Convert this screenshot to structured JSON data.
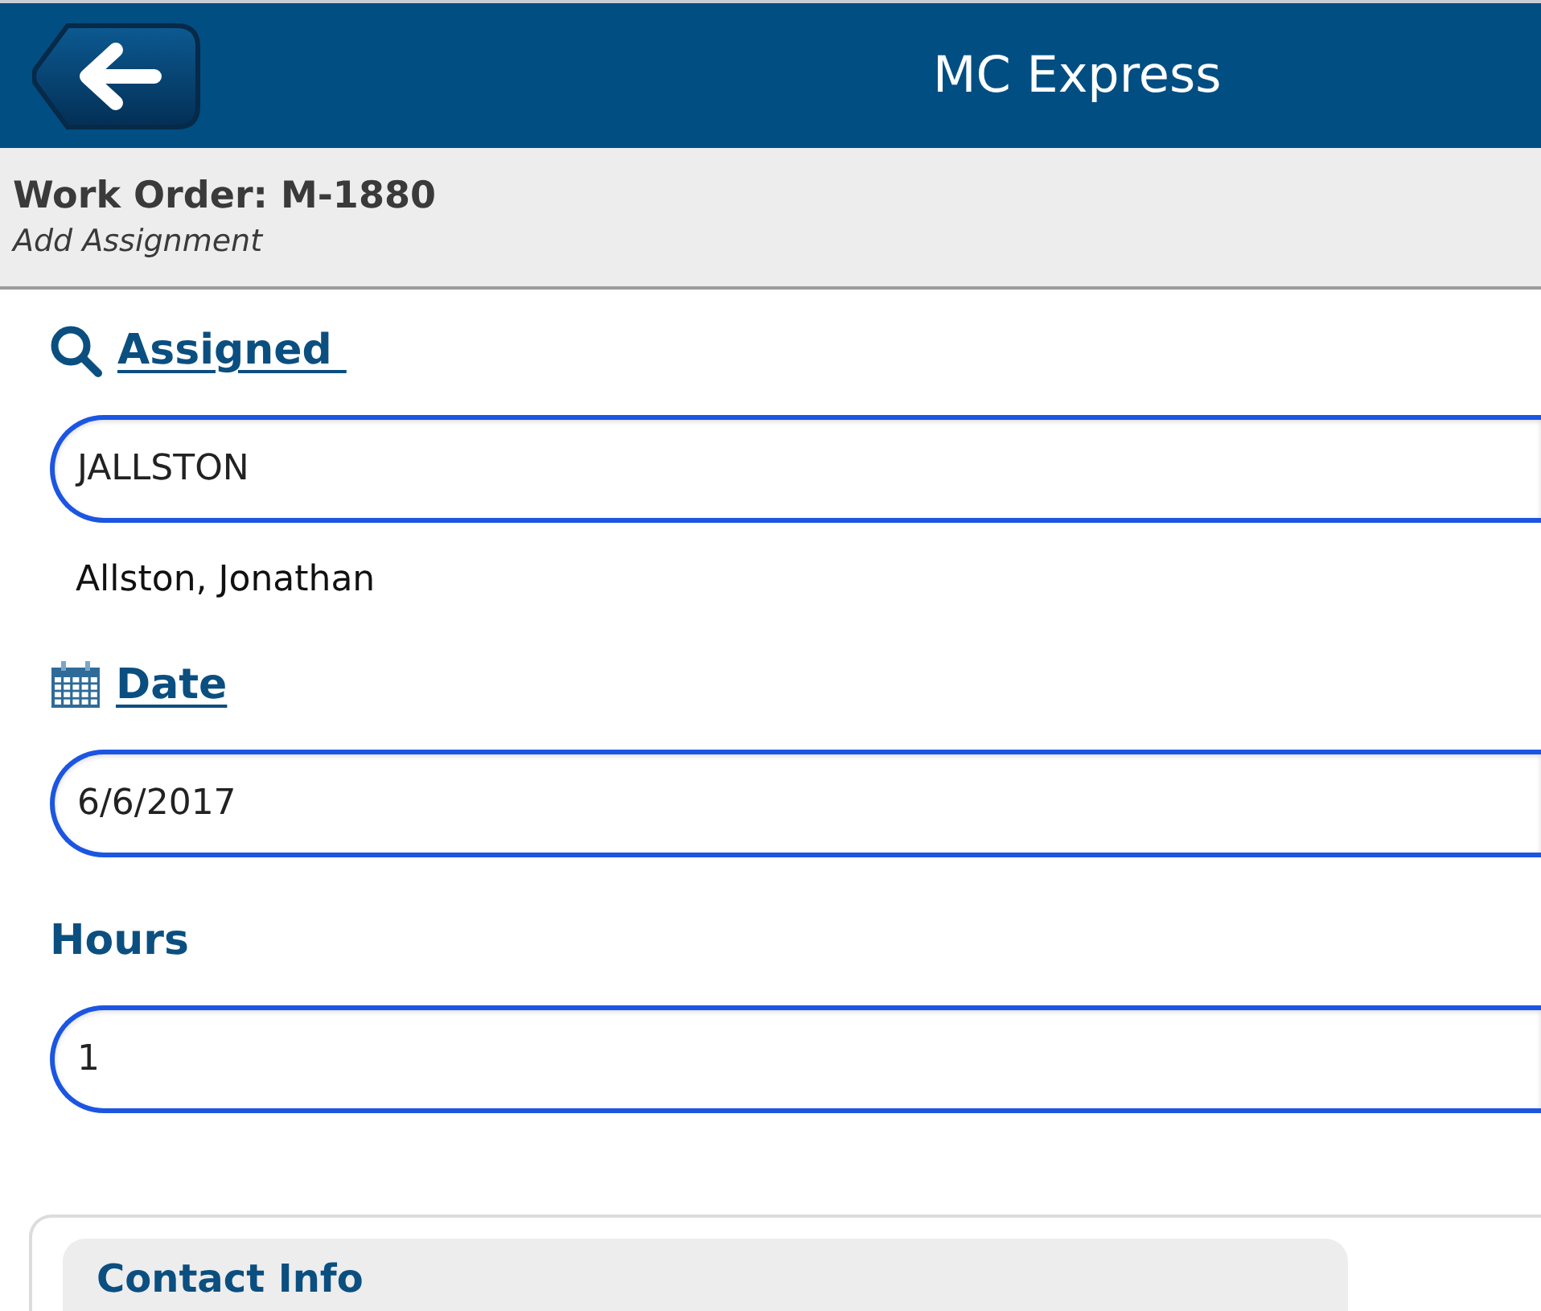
{
  "header": {
    "title": "MC Express"
  },
  "subheader": {
    "title": "Work Order: M-1880",
    "subtitle": "Add Assignment"
  },
  "fields": [
    {
      "kind": "lookup",
      "label": "Assigned ",
      "value": "JALLSTON",
      "description": "Allston, Jonathan"
    },
    {
      "kind": "date",
      "label": "Date",
      "value": "6/6/2017"
    },
    {
      "kind": "plain",
      "label": "Hours",
      "value": "1"
    }
  ],
  "section": {
    "title": "Contact Info"
  }
}
